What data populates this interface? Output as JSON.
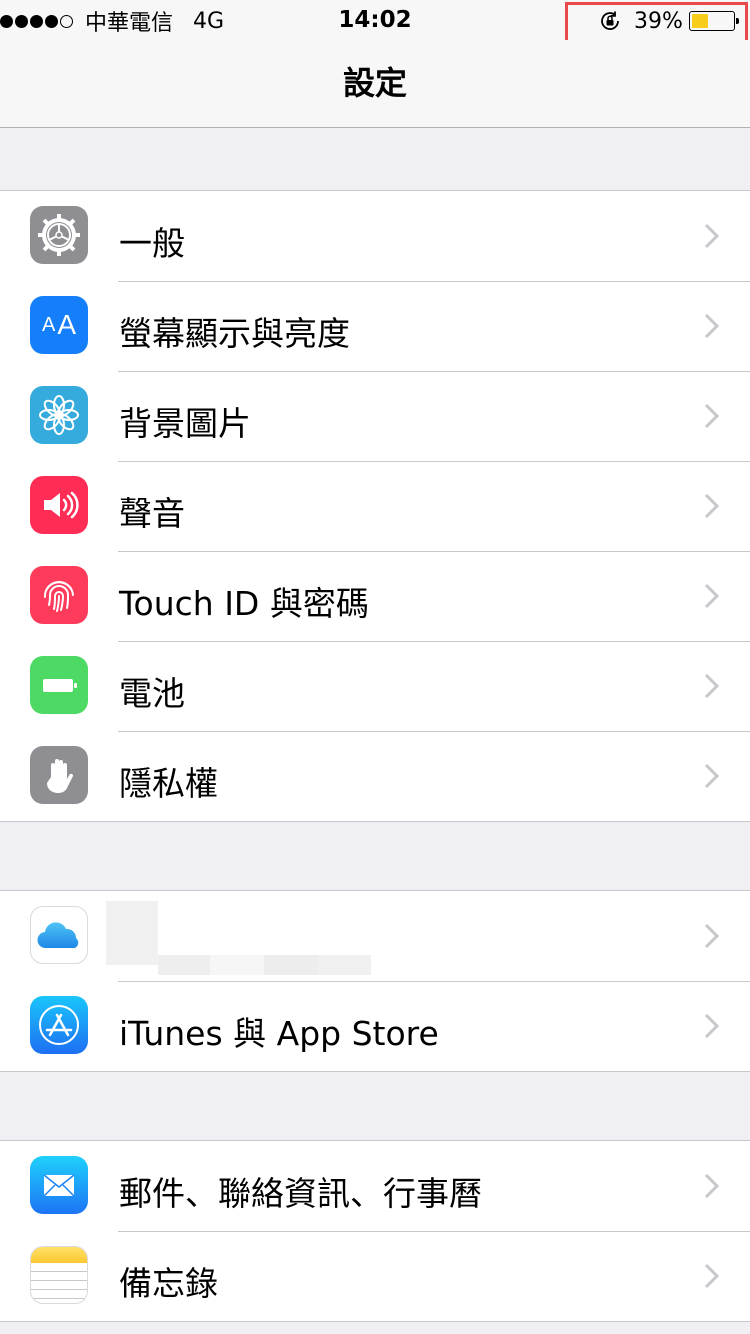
{
  "status_bar": {
    "carrier": "中華電信",
    "network": "4G",
    "time": "14:02",
    "battery_percent": "39%",
    "battery_level": 0.39,
    "orientation_lock_icon": "orientation-lock-icon"
  },
  "nav": {
    "title": "設定"
  },
  "groups": [
    {
      "rows": [
        {
          "label": "一般",
          "icon": "gear-icon",
          "color": "#8e8e93"
        },
        {
          "label": "螢幕顯示與亮度",
          "icon": "text-size-icon",
          "color": "#147efb"
        },
        {
          "label": "背景圖片",
          "icon": "flower-icon",
          "color": "#35aadc"
        },
        {
          "label": "聲音",
          "icon": "speaker-icon",
          "color": "#ff2d55"
        },
        {
          "label": "Touch ID 與密碼",
          "icon": "fingerprint-icon",
          "color": "#ff3b5c"
        },
        {
          "label": "電池",
          "icon": "battery-icon",
          "color": "#4cd964"
        },
        {
          "label": "隱私權",
          "icon": "hand-icon",
          "color": "#8e8e93"
        }
      ]
    },
    {
      "rows": [
        {
          "label": "",
          "icon": "icloud-icon",
          "color": "#ffffff"
        },
        {
          "label": "iTunes 與 App Store",
          "icon": "app-store-icon",
          "color": "#1d8cf5"
        }
      ]
    },
    {
      "rows": [
        {
          "label": "郵件、聯絡資訊、行事曆",
          "icon": "mail-icon",
          "color": "#1e8cf7"
        },
        {
          "label": "備忘錄",
          "icon": "notes-icon",
          "color": "#ffd23c"
        }
      ]
    }
  ],
  "colors": {
    "highlight_box": "#e84a4a",
    "separator": "#c8c7cc",
    "background": "#efeff4"
  }
}
